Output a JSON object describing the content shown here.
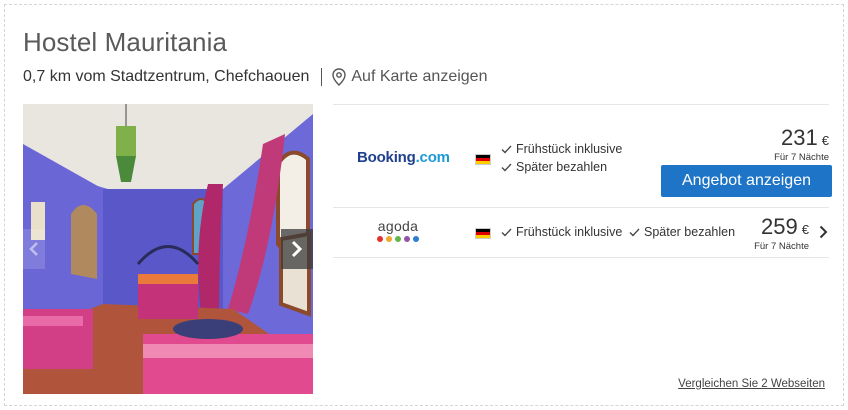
{
  "hotel": {
    "name": "Hostel Mauritania",
    "distance": "0,7 km vom Stadtzentrum, Chefchaouen",
    "map_link": "Auf Karte anzeigen"
  },
  "offers": [
    {
      "provider": "Booking.com",
      "provider_parts": [
        "Booking",
        ".com"
      ],
      "flag": "germany-flag",
      "features": [
        "Frühstück inklusive",
        "Später bezahlen"
      ],
      "price": "231",
      "currency": "€",
      "price_note": "Für 7 Nächte",
      "cta": "Angebot anzeigen"
    },
    {
      "provider": "agoda",
      "flag": "germany-flag",
      "features": [
        "Frühstück inklusive",
        "Später bezahlen"
      ],
      "price": "259",
      "currency": "€",
      "price_note": "Für 7 Nächte"
    }
  ],
  "compare_link": "Vergleichen Sie 2 Webseiten",
  "colors": {
    "cta": "#1e74c6",
    "booking_blue": "#1f3f8f",
    "booking_light": "#1b9ad6",
    "agoda_dots": [
      "#e5312d",
      "#f4a62a",
      "#63b649",
      "#9056a3",
      "#2a7ecb"
    ]
  }
}
